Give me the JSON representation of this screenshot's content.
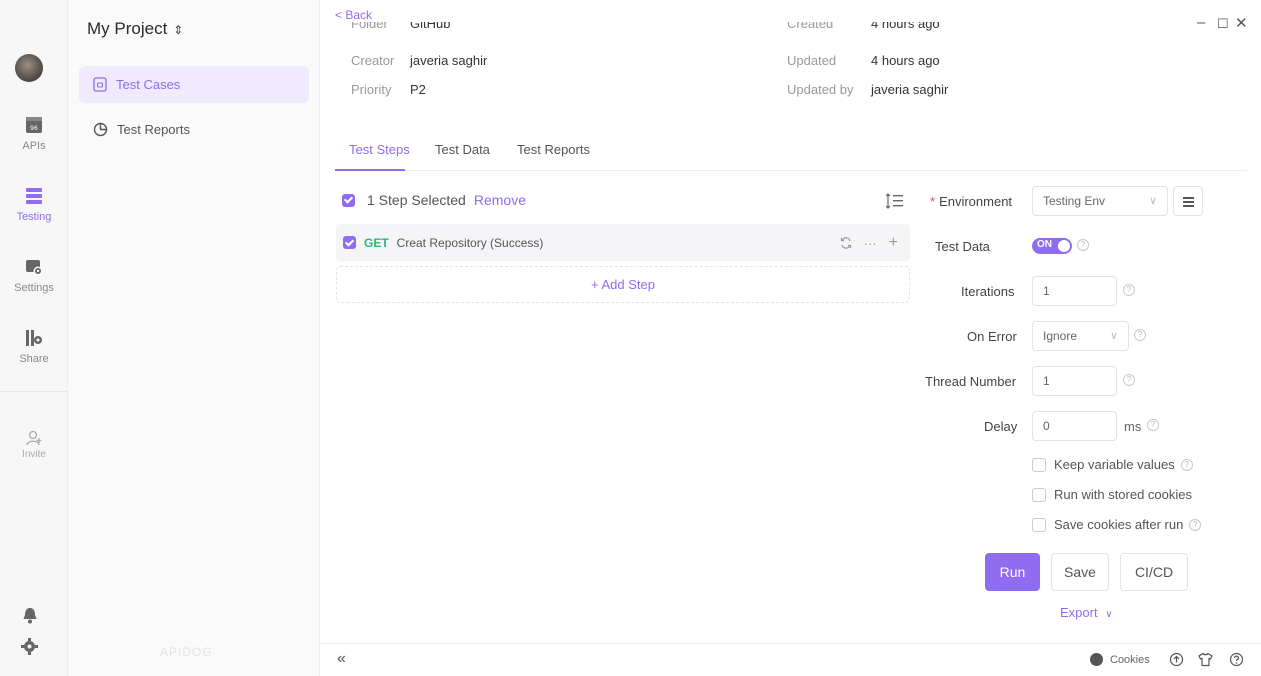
{
  "rail": {
    "items": [
      {
        "label": "APIs",
        "icon": "api-icon"
      },
      {
        "label": "Testing",
        "icon": "testing-icon"
      },
      {
        "label": "Settings",
        "icon": "settings-icon"
      },
      {
        "label": "Share",
        "icon": "share-icon"
      },
      {
        "label": "Invite",
        "icon": "invite-icon"
      }
    ],
    "active": "Testing",
    "accent": "#8f6cf0"
  },
  "sidebar": {
    "project_title": "My Project",
    "items": [
      {
        "label": "Test Cases",
        "active": true
      },
      {
        "label": "Test Reports",
        "active": false
      }
    ],
    "watermark": "APIDOG"
  },
  "header": {
    "back_label": "< Back",
    "meta": {
      "folder_label": "Folder",
      "folder_value": "GitHub",
      "created_label": "Created",
      "created_value": "4 hours ago",
      "creator_label": "Creator",
      "creator_value": "javeria saghir",
      "updated_label": "Updated",
      "updated_value": "4 hours ago",
      "priority_label": "Priority",
      "priority_value": "P2",
      "updated_by_label": "Updated by",
      "updated_by_value": "javeria saghir"
    }
  },
  "tabs": [
    {
      "label": "Test Steps",
      "active": true
    },
    {
      "label": "Test Data",
      "active": false
    },
    {
      "label": "Test Reports",
      "active": false
    }
  ],
  "steps": {
    "selection_text": "1 Step Selected",
    "remove_label": "Remove",
    "rows": [
      {
        "method": "GET",
        "name": "Creat Repository (Success)",
        "checked": true
      }
    ],
    "add_step_label": "+ Add Step"
  },
  "run_config": {
    "environment_label": "Environment",
    "environment_value": "Testing Env",
    "test_data_label": "Test Data",
    "test_data_toggle": "ON",
    "iterations_label": "Iterations",
    "iterations_value": "1",
    "on_error_label": "On Error",
    "on_error_value": "Ignore",
    "thread_number_label": "Thread Number",
    "thread_number_value": "1",
    "delay_label": "Delay",
    "delay_value": "0",
    "delay_unit": "ms",
    "options": [
      {
        "label": "Keep variable values",
        "checked": false,
        "help": true
      },
      {
        "label": "Run with stored cookies",
        "checked": false,
        "help": false
      },
      {
        "label": "Save cookies after run",
        "checked": false,
        "help": true
      }
    ]
  },
  "actions": {
    "run_label": "Run",
    "save_label": "Save",
    "cicd_label": "CI/CD",
    "export_label": "Export"
  },
  "footer": {
    "cookies_label": "Cookies"
  }
}
